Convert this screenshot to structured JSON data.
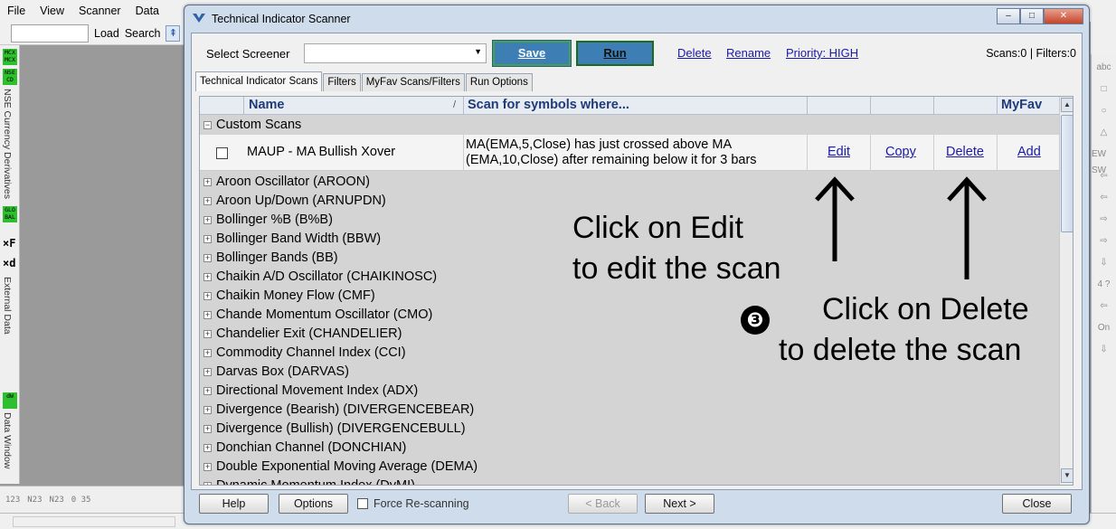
{
  "app": {
    "menu": [
      "File",
      "View",
      "Scanner",
      "Data"
    ],
    "toolbar": {
      "load": "Load",
      "search": "Search"
    },
    "left_panels": {
      "badges": [
        "MCX MCX",
        "NSE CD",
        "GLO BAL",
        "dW"
      ],
      "currency": "NSE Currency Derivatives",
      "external": "External Data",
      "window": "Data Window",
      "fx": "×F",
      "xd": "×d"
    },
    "bottom_tools": [
      "123",
      "N23",
      "N23",
      "0 35"
    ],
    "right_tools": [
      "abc",
      "□",
      "○",
      "△",
      "EW SW",
      "⇦",
      "⇦",
      "⇨",
      "⇨",
      "⇩",
      "4 ?",
      "⇦",
      "On",
      "⇩"
    ]
  },
  "dialog": {
    "title": "Technical Indicator Scanner",
    "window_buttons": {
      "minimize": "–",
      "maximize": "□",
      "close": "✕"
    },
    "select_label": "Select Screener",
    "screener_value": "",
    "buttons": {
      "save": "Save",
      "run": "Run"
    },
    "links": {
      "delete": "Delete",
      "rename": "Rename",
      "priority": "Priority: HIGH"
    },
    "counts": "Scans:0 | Filters:0",
    "tabs": [
      "Technical Indicator Scans",
      "Filters",
      "MyFav Scans/Filters",
      "Run Options"
    ],
    "grid": {
      "col_name": "Name",
      "col_scan": "Scan for symbols where...",
      "col_myfav": "MyFav",
      "sort_mark": "/",
      "custom_group": "Custom Scans",
      "custom_scan": {
        "name": "MAUP - MA Bullish Xover",
        "description": "MA(EMA,5,Close) has just crossed above MA (EMA,10,Close) after remaining below it for 3 bars",
        "actions": [
          "Edit",
          "Copy",
          "Delete",
          "Add"
        ]
      },
      "indicator_groups": [
        "Aroon Oscillator (AROON)",
        "Aroon Up/Down (ARNUPDN)",
        "Bollinger %B (B%B)",
        "Bollinger Band Width (BBW)",
        "Bollinger Bands (BB)",
        "Chaikin A/D Oscillator (CHAIKINOSC)",
        "Chaikin Money Flow (CMF)",
        "Chande Momentum Oscillator (CMO)",
        "Chandelier Exit (CHANDELIER)",
        "Commodity Channel Index (CCI)",
        "Darvas Box (DARVAS)",
        "Directional Movement Index (ADX)",
        "Divergence (Bearish) (DIVERGENCEBEAR)",
        "Divergence (Bullish) (DIVERGENCEBULL)",
        "Donchian Channel (DONCHIAN)",
        "Double Exponential Moving Average (DEMA)",
        "Dynamic Momentum Index (DyMI)"
      ]
    },
    "annotations": {
      "edit_line1": "Click on Edit",
      "edit_line2": "to edit the scan",
      "delete_line1": "Click on Delete",
      "delete_line2": "to delete the scan",
      "step": "❸"
    },
    "footer": {
      "help": "Help",
      "options": "Options",
      "force": "Force Re-scanning",
      "back": "< Back",
      "next": "Next >",
      "close": "Close"
    }
  }
}
